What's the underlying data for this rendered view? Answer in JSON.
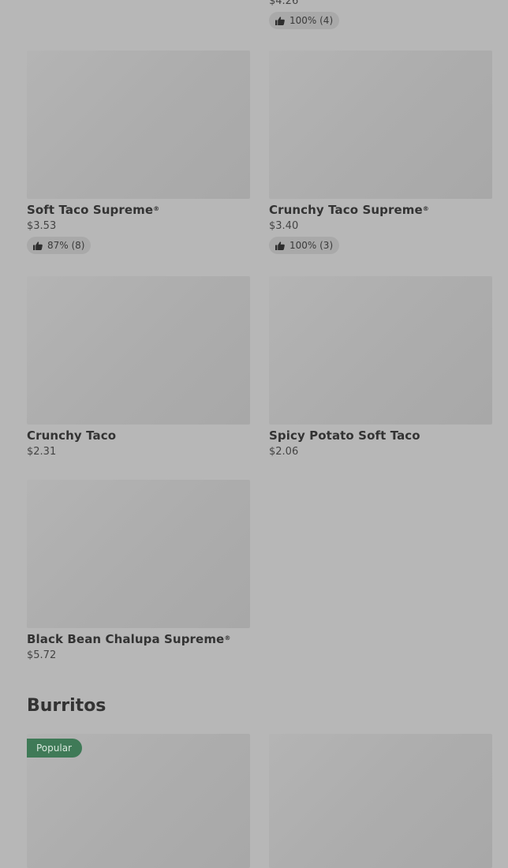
{
  "partial_item": {
    "price": "$4.26",
    "rating": "100% (4)"
  },
  "items": [
    {
      "name": "Soft Taco Supreme",
      "mark": "®",
      "price": "$3.53",
      "rating": "87% (8)"
    },
    {
      "name": "Crunchy Taco Supreme",
      "mark": "®",
      "price": "$3.40",
      "rating": "100% (3)"
    },
    {
      "name": "Crunchy Taco",
      "price": "$2.31"
    },
    {
      "name": "Spicy Potato Soft Taco",
      "price": "$2.06"
    },
    {
      "name": "Black Bean Chalupa Supreme",
      "mark": "®",
      "price": "$5.72"
    }
  ],
  "burritos": {
    "title": "Burritos",
    "badge": "Popular"
  },
  "icons": {
    "rating": "thumbs-up-icon"
  },
  "colors": {
    "badge": "#3f7a57",
    "overlay_bg": "#b7b7b7"
  }
}
